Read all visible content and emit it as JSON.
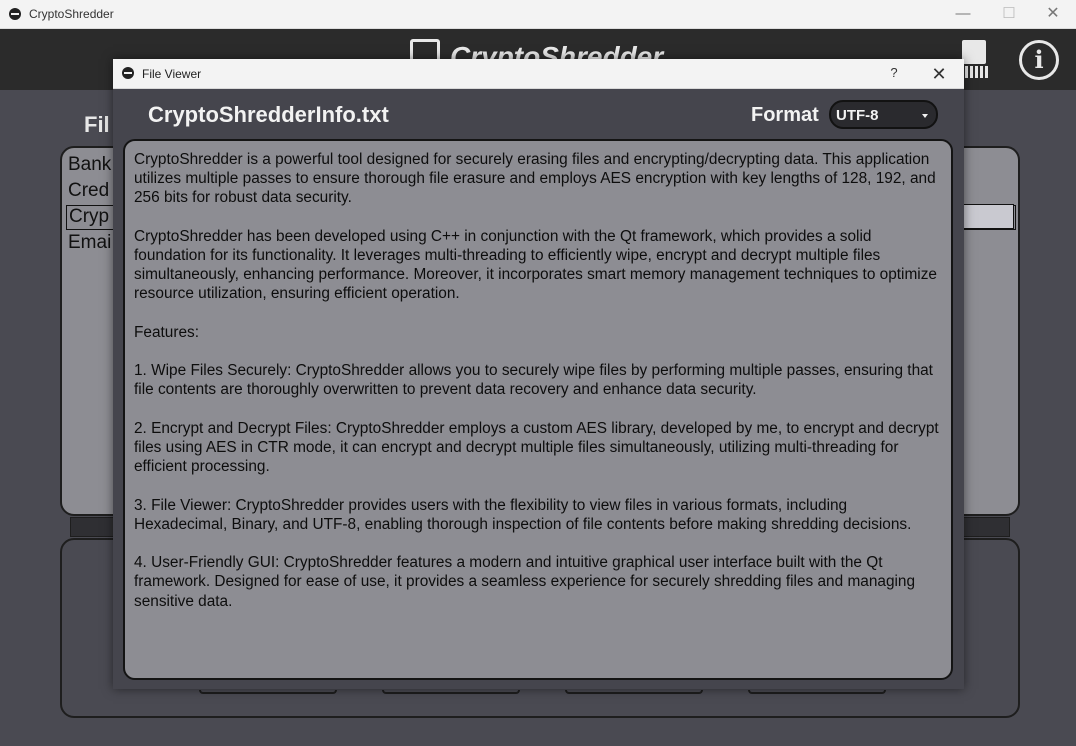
{
  "window": {
    "title": "CryptoShredder",
    "controls": {
      "minimize": "—",
      "maximize": "☐",
      "close": "✕"
    }
  },
  "header": {
    "logo_text": "CryptoShredder",
    "info_icon_text": "i"
  },
  "background": {
    "heading": "Fil",
    "items": [
      "Bank",
      "Cred",
      "Cryp",
      "Emai"
    ]
  },
  "dialog": {
    "title": "File Viewer",
    "help_label": "?",
    "close_label": "✕",
    "file_name": "CryptoShredderInfo.txt",
    "format_label": "Format",
    "format_value": "UTF-8",
    "paragraphs": [
      "CryptoShredder is a powerful tool designed for securely erasing files and encrypting/decrypting data. This application utilizes multiple passes to ensure thorough file erasure and employs AES encryption with key lengths of 128, 192, and 256 bits for robust data security.",
      "CryptoShredder has been developed using C++ in conjunction with the Qt framework, which provides a solid foundation for its functionality. It leverages multi-threading to efficiently wipe, encrypt and decrypt multiple files simultaneously, enhancing performance. Moreover, it incorporates smart memory management techniques to optimize resource utilization, ensuring efficient operation.",
      "Features:",
      "1. Wipe Files Securely: CryptoShredder allows you to securely wipe files by performing multiple passes, ensuring that file contents are thoroughly overwritten to prevent data recovery and enhance data security.",
      "2. Encrypt and Decrypt Files: CryptoShredder employs a custom AES library, developed by me, to encrypt and decrypt files using AES in CTR mode, it can encrypt and decrypt multiple files simultaneously, utilizing multi-threading for efficient processing.",
      "3. File Viewer: CryptoShredder provides users with the flexibility to view files in various formats, including Hexadecimal, Binary, and UTF-8, enabling thorough inspection of file contents before making shredding decisions.",
      "4. User-Friendly GUI: CryptoShredder features a modern and intuitive graphical user interface built with the Qt framework. Designed for ease of use, it provides a seamless experience for securely shredding files and managing sensitive data."
    ]
  },
  "colors": {
    "app_background": "#4a4a52",
    "header_background": "#2b2b2b",
    "panel_background": "#8d8d93",
    "dialog_background": "#45454d",
    "text_light": "#f2f2f2"
  }
}
